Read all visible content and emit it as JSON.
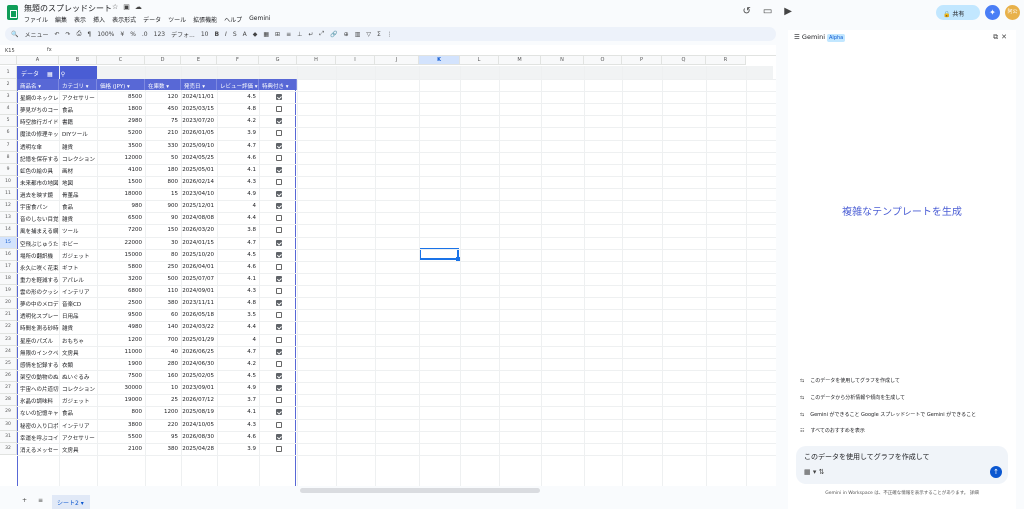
{
  "app": {
    "title": "無題のスプレッドシート",
    "menu": [
      "ファイル",
      "編集",
      "表示",
      "挿入",
      "表示形式",
      "データ",
      "ツール",
      "拡張機能",
      "ヘルプ",
      "Gemini"
    ],
    "share": "共有",
    "avatar": "阿公"
  },
  "toolbar": {
    "search": "メニュー",
    "zoom": "100%",
    "percent": "%",
    "decimals": ".0",
    ".00": ".00",
    "numfmt": "123",
    "font": "デフォ...",
    "fontsize": "10",
    "bold": "B",
    "italic": "I"
  },
  "formula": {
    "cellref": "K15",
    "fx": "fx"
  },
  "columns": [
    "A",
    "B",
    "C",
    "D",
    "E",
    "F",
    "G",
    "H",
    "I",
    "J",
    "K",
    "L",
    "M",
    "N",
    "O",
    "P",
    "Q",
    "R"
  ],
  "selected_column": "K",
  "table": {
    "name": "データ",
    "headers": [
      "商品名",
      "カテゴリ",
      "価格 (JPY)",
      "在庫数",
      "発売日",
      "レビュー評価",
      "特典付き"
    ],
    "rows": [
      [
        "星網のネックレ",
        "アクセサリー",
        "8500",
        "120",
        "2024/11/01",
        "4.5",
        true
      ],
      [
        "夢見がちのコー",
        "食品",
        "1800",
        "450",
        "2025/03/15",
        "4.8",
        false
      ],
      [
        "時空旅行ガイド",
        "書籍",
        "2980",
        "75",
        "2023/07/20",
        "4.2",
        true
      ],
      [
        "魔法の修理キッ",
        "DIYツール",
        "5200",
        "210",
        "2026/01/05",
        "3.9",
        false
      ],
      [
        "透明な傘",
        "雑貨",
        "3500",
        "330",
        "2025/09/10",
        "4.7",
        true
      ],
      [
        "記憶を保存する!",
        "コレクション",
        "12000",
        "50",
        "2024/05/25",
        "4.6",
        false
      ],
      [
        "虹色の絵の具",
        "画材",
        "4100",
        "180",
        "2025/05/01",
        "4.1",
        true
      ],
      [
        "未来都市の地図",
        "地図",
        "1500",
        "800",
        "2026/02/14",
        "4.3",
        false
      ],
      [
        "過去を映す鏡",
        "骨董品",
        "18000",
        "15",
        "2023/04/10",
        "4.9",
        true
      ],
      [
        "宇宙食パン",
        "食品",
        "980",
        "900",
        "2025/12/01",
        "4",
        true
      ],
      [
        "音のしない目覚",
        "雑貨",
        "6500",
        "90",
        "2024/08/08",
        "4.4",
        false
      ],
      [
        "風を捕まえる網",
        "ツール",
        "7200",
        "150",
        "2026/03/20",
        "3.8",
        false
      ],
      [
        "空飛ぶじゅうた",
        "ホビー",
        "22000",
        "30",
        "2024/01/15",
        "4.7",
        true
      ],
      [
        "場所の翻訳機",
        "ガジェット",
        "15000",
        "80",
        "2025/10/20",
        "4.5",
        true
      ],
      [
        "永久に咲く花束",
        "ギフト",
        "5800",
        "250",
        "2026/04/01",
        "4.6",
        false
      ],
      [
        "重力を軽減する!",
        "アパレル",
        "3200",
        "500",
        "2025/07/07",
        "4.1",
        true
      ],
      [
        "雲の形のクッシ",
        "インテリア",
        "6800",
        "110",
        "2024/09/01",
        "4.3",
        false
      ],
      [
        "夢の中のメロデ",
        "音楽CD",
        "2500",
        "380",
        "2023/11/11",
        "4.8",
        true
      ],
      [
        "透明化スプレー",
        "日用品",
        "9500",
        "60",
        "2026/05/18",
        "3.5",
        false
      ],
      [
        "時間を測る砂時",
        "雑貨",
        "4980",
        "140",
        "2024/03/22",
        "4.4",
        true
      ],
      [
        "星座のパズル",
        "おもちゃ",
        "1200",
        "700",
        "2025/01/29",
        "4",
        false
      ],
      [
        "無限のインクペ",
        "文房具",
        "11000",
        "40",
        "2026/06/25",
        "4.7",
        true
      ],
      [
        "感情を記録する!",
        "衣類",
        "1900",
        "280",
        "2024/06/30",
        "4.2",
        false
      ],
      [
        "架空の動物のぬ",
        "ぬいぐるみ",
        "7500",
        "160",
        "2025/02/05",
        "4.5",
        true
      ],
      [
        "宇宙への片道切",
        "コレクション",
        "30000",
        "10",
        "2023/09/01",
        "4.9",
        true
      ],
      [
        "氷晶の調味料",
        "ガジェット",
        "19000",
        "25",
        "2026/07/12",
        "3.7",
        false
      ],
      [
        "ないの記憶キャ",
        "食品",
        "800",
        "1200",
        "2025/08/19",
        "4.1",
        true
      ],
      [
        "秘密の入り口ポ",
        "インテリア",
        "3800",
        "220",
        "2024/10/05",
        "4.3",
        false
      ],
      [
        "幸運を呼ぶコイ",
        "アクセサリー",
        "5500",
        "95",
        "2026/08/30",
        "4.6",
        true
      ],
      [
        "消えるメッセー",
        "文房具",
        "2100",
        "380",
        "2025/04/28",
        "3.9",
        false
      ]
    ]
  },
  "sheet_tab": "シート2",
  "gemini": {
    "title": "Gemini",
    "badge": "Alpha",
    "generate": "複雑なテンプレートを生成",
    "suggestions": [
      "このデータを使用してグラフを作成して",
      "このデータから分析情報や傾向を生成して",
      "Gemini ができること Google スプレッドシートで Gemini ができること",
      "すべてのおすすめを表示"
    ],
    "input": "このデータを使用してグラフを作成して",
    "footer": "Gemini in Workspace は、不正確な情報を表示することがあります。 詳細"
  }
}
